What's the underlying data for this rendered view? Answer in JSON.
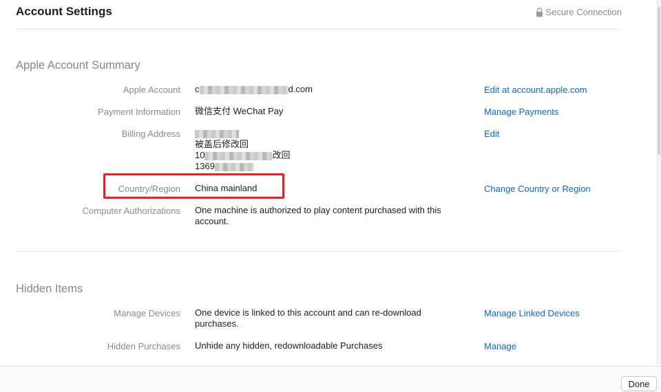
{
  "header": {
    "title": "Account Settings",
    "secure_label": "Secure Connection",
    "secure_icon": "lock-icon"
  },
  "summary": {
    "title": "Apple Account Summary",
    "apple_account": {
      "label": "Apple Account",
      "value_start": "c",
      "value_end": "d.com",
      "action": "Edit at account.apple.com"
    },
    "payment": {
      "label": "Payment Information",
      "value": "微信支付 WeChat Pay",
      "action": "Manage Payments"
    },
    "billing": {
      "label": "Billing Address",
      "line2": "被盖后修改回",
      "line3_start": "10",
      "line3_end": "改回",
      "line4_start": "1369",
      "action": "Edit"
    },
    "country": {
      "label": "Country/Region",
      "value": "China mainland",
      "action": "Change Country or Region"
    },
    "authorizations": {
      "label": "Computer Authorizations",
      "value": "One machine is authorized to play content purchased with this account."
    }
  },
  "hidden": {
    "title": "Hidden Items",
    "devices": {
      "label": "Manage Devices",
      "value": "One device is linked to this account and can re-download purchases.",
      "action": "Manage Linked Devices"
    },
    "purchases": {
      "label": "Hidden Purchases",
      "value": "Unhide any hidden, redownloadable Purchases",
      "action": "Manage"
    }
  },
  "footer": {
    "done_label": "Done"
  },
  "colors": {
    "link": "#0a67d8",
    "highlight_box": "#ee1f1f",
    "label": "#8a8a8e"
  }
}
